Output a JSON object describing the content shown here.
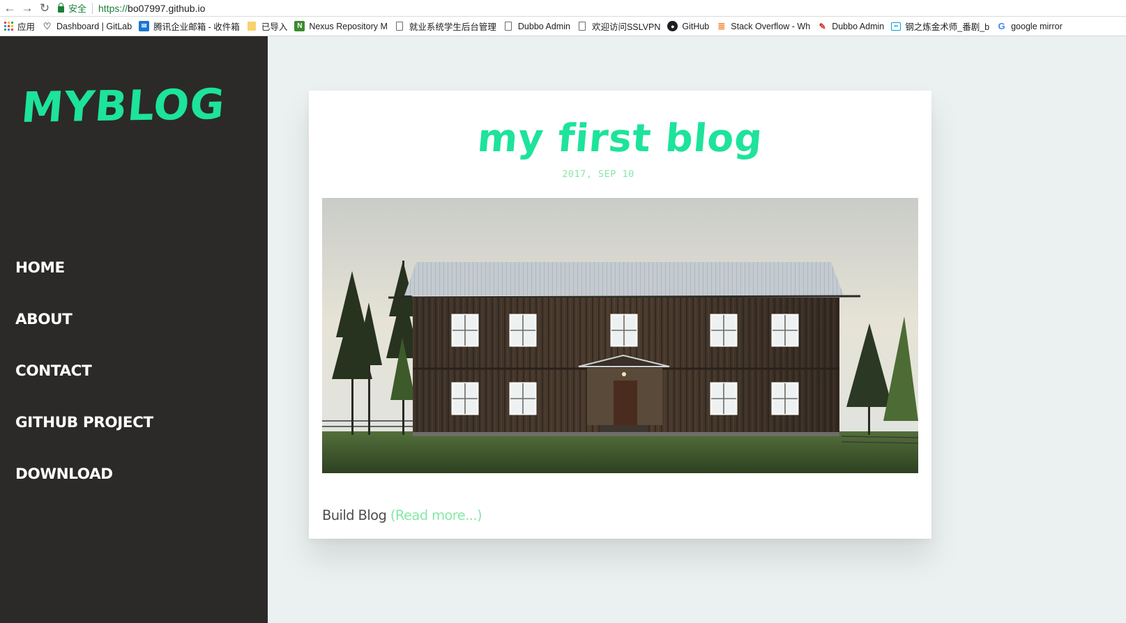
{
  "browser": {
    "secure_label": "安全",
    "url_scheme": "https://",
    "url_host": "bo07997.github.io"
  },
  "bookmarks": [
    {
      "label": "应用",
      "icon": "apps-grid-icon"
    },
    {
      "label": "Dashboard | GitLab",
      "icon": "gitlab-icon"
    },
    {
      "label": "腾讯企业邮箱 - 收件箱",
      "icon": "tencent-mail-icon"
    },
    {
      "label": "已导入",
      "icon": "folder-icon"
    },
    {
      "label": "Nexus Repository M",
      "icon": "nexus-icon"
    },
    {
      "label": "就业系统学生后台管理",
      "icon": "page-icon"
    },
    {
      "label": "Dubbo Admin",
      "icon": "page-icon"
    },
    {
      "label": "欢迎访问SSLVPN",
      "icon": "page-icon"
    },
    {
      "label": "GitHub",
      "icon": "github-icon"
    },
    {
      "label": "Stack Overflow - Wh",
      "icon": "stackoverflow-icon"
    },
    {
      "label": "Dubbo Admin",
      "icon": "dubbo-icon"
    },
    {
      "label": "钢之炼金术师_番剧_b",
      "icon": "bilibili-icon"
    },
    {
      "label": "google mirror",
      "icon": "google-icon"
    }
  ],
  "sidebar": {
    "logo": "MYBLOG",
    "nav": [
      "HOME",
      "ABOUT",
      "CONTACT",
      "GITHUB PROJECT",
      "DOWNLOAD"
    ]
  },
  "post": {
    "title": "my first blog",
    "date": "2017, SEP 10",
    "excerpt": "Build Blog",
    "read_more": "(Read more...)"
  },
  "colors": {
    "accent": "#1de39b",
    "light_accent": "#86e8a8",
    "sidebar_bg": "#2b2a28",
    "page_bg": "#eaf1f0"
  }
}
